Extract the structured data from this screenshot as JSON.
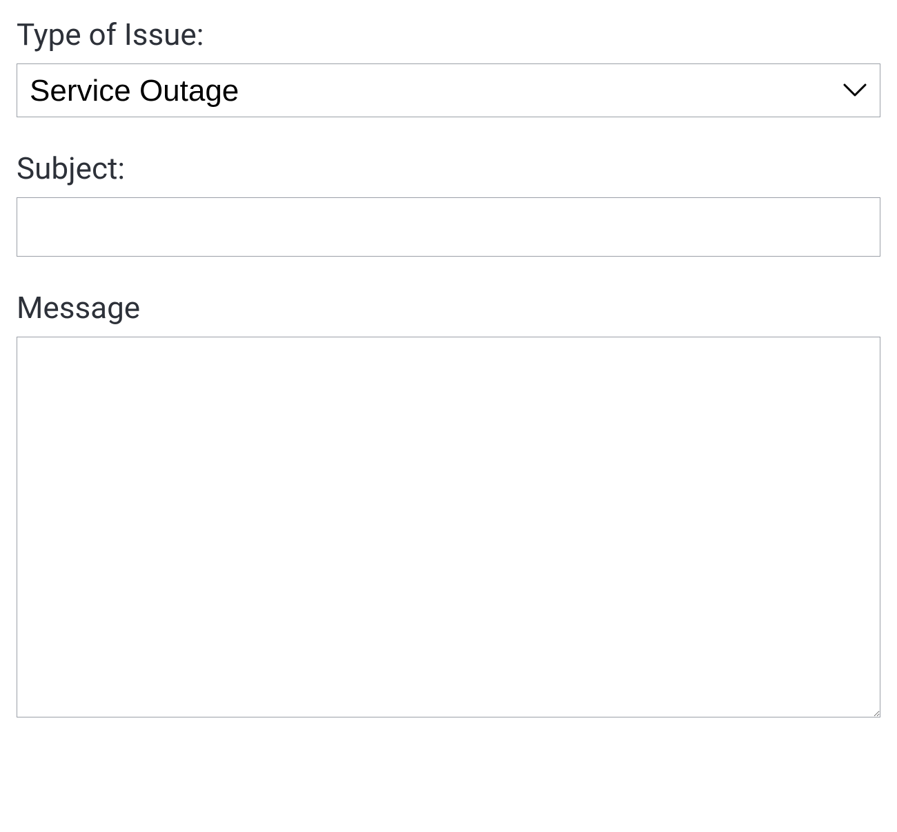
{
  "form": {
    "issue_type": {
      "label": "Type of Issue:",
      "selected": "Service Outage"
    },
    "subject": {
      "label": "Subject:",
      "value": ""
    },
    "message": {
      "label": "Message",
      "value": ""
    }
  }
}
